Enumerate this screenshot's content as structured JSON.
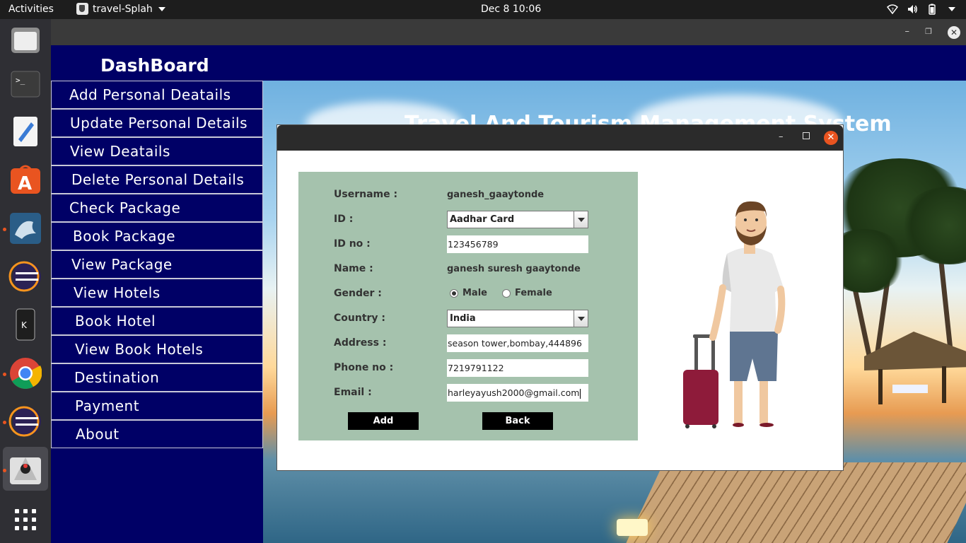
{
  "topbar": {
    "activities": "Activities",
    "app_name": "travel-Splah",
    "clock": "Dec 8  10:06"
  },
  "dock": {
    "items": [
      "files-icon",
      "terminal-icon",
      "text-editor-icon",
      "app-center-icon",
      "mysql-workbench-icon",
      "eclipse-icon",
      "kde-connect-icon",
      "chrome-icon",
      "eclipse-2-icon",
      "java-app-icon",
      "show-apps-icon"
    ]
  },
  "dashboard": {
    "title": "DashBoard",
    "menu": [
      "Add Personal Deatails",
      "Update Personal Details",
      "View Deatails",
      "Delete Personal Details",
      "Check Package",
      "Book Package",
      "View Package",
      "View Hotels",
      "Book Hotel",
      "View Book Hotels",
      "Destination",
      "Payment",
      "About"
    ]
  },
  "background": {
    "title": "Travel And Tourism Management System"
  },
  "dialog": {
    "labels": {
      "username": "Username :",
      "id": "ID :",
      "id_no": "ID no :",
      "name": "Name :",
      "gender": "Gender :",
      "country": "Country :",
      "address": "Address :",
      "phone": "Phone no :",
      "email": "Email :"
    },
    "values": {
      "username": "ganesh_gaaytonde",
      "id_type": "Aadhar Card",
      "id_no": "123456789",
      "name": "ganesh suresh gaaytonde",
      "gender_male": "Male",
      "gender_female": "Female",
      "gender_selected": "Male",
      "country": "India",
      "address": "season tower,bombay,444896",
      "phone": "7219791122",
      "email": "harleyayush2000@gmail.com"
    },
    "buttons": {
      "add": "Add",
      "back": "Back"
    }
  },
  "colors": {
    "dashboard_bg": "#000066",
    "form_bg": "#a5c2ad",
    "ubuntu_orange": "#e95420"
  }
}
